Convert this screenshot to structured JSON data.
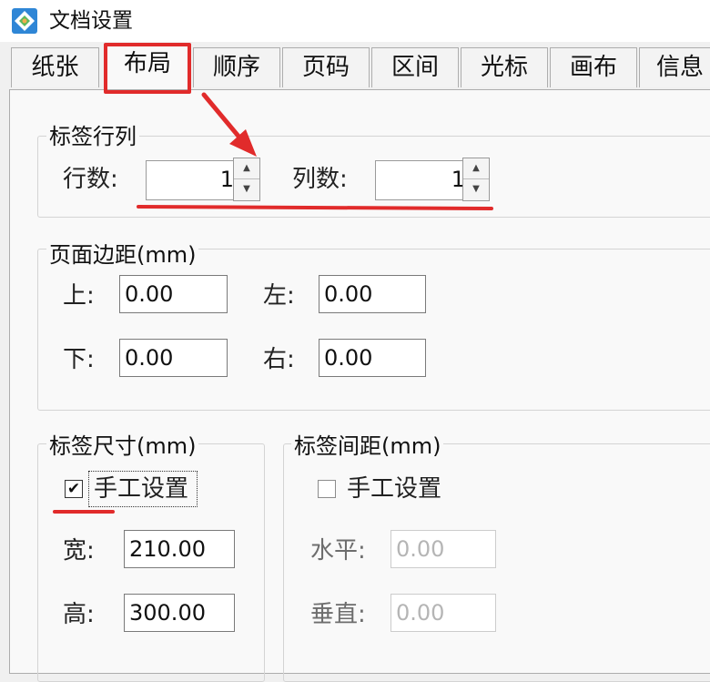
{
  "window": {
    "title": "文档设置",
    "icon": "app-logo-icon"
  },
  "tabs": [
    {
      "label": "纸张",
      "active": false
    },
    {
      "label": "布局",
      "active": true
    },
    {
      "label": "顺序",
      "active": false
    },
    {
      "label": "页码",
      "active": false
    },
    {
      "label": "区间",
      "active": false
    },
    {
      "label": "光标",
      "active": false
    },
    {
      "label": "画布",
      "active": false
    },
    {
      "label": "信息",
      "active": false
    }
  ],
  "label_grid": {
    "legend": "标签行列",
    "rows_label": "行数:",
    "rows_value": "1",
    "cols_label": "列数:",
    "cols_value": "1"
  },
  "page_margins": {
    "legend": "页面边距(mm)",
    "top_label": "上:",
    "top_value": "0.00",
    "left_label": "左:",
    "left_value": "0.00",
    "bottom_label": "下:",
    "bottom_value": "0.00",
    "right_label": "右:",
    "right_value": "0.00"
  },
  "label_size": {
    "legend": "标签尺寸(mm)",
    "manual_label": "手工设置",
    "manual_checked": true,
    "width_label": "宽:",
    "width_value": "210.00",
    "height_label": "高:",
    "height_value": "300.00"
  },
  "label_spacing": {
    "legend": "标签间距(mm)",
    "manual_label": "手工设置",
    "manual_checked": false,
    "horizontal_label": "水平:",
    "horizontal_value": "0.00",
    "vertical_label": "垂直:",
    "vertical_value": "0.00"
  },
  "colors": {
    "annotation_red": "#e12b2b",
    "panel_bg": "#f9f9f9",
    "window_bg": "#f0f0f0"
  }
}
